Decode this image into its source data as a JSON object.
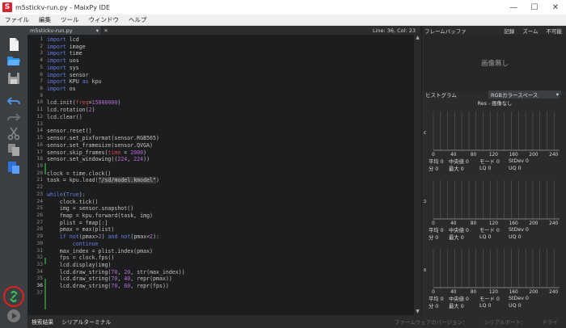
{
  "window": {
    "title": "m5stickv-run.py - MaixPy IDE",
    "logo_letter": "S",
    "minimize": "—",
    "maximize": "☐",
    "close": "✕"
  },
  "menu": [
    "ファイル",
    "編集",
    "ツール",
    "ウィンドウ",
    "ヘルプ"
  ],
  "toolbar": {
    "icons": [
      "new-file-icon",
      "open-folder-icon",
      "save-icon",
      "undo-icon",
      "redo-icon",
      "cut-icon",
      "copy-icon",
      "paste-icon",
      "connect-link-icon",
      "run-icon"
    ],
    "connect_highlight_color": "#e02020"
  },
  "editor": {
    "file_name": "m5stickv-run.py",
    "dropdown_arrow": "▾",
    "close_tab": "✕",
    "cursor_position": "Line: 36, Col: 23",
    "line_numbers": [
      "1",
      "2",
      "3",
      "4",
      "5",
      "6",
      "7",
      "8",
      "9",
      "10",
      "11",
      "12",
      "13",
      "14",
      "15",
      "16",
      "17",
      "18",
      "19",
      "20",
      "21",
      "22",
      "23",
      "24",
      "25",
      "26",
      "27",
      "28",
      "29",
      "30",
      "31",
      "32",
      "33",
      "34",
      "35",
      "36",
      "37"
    ]
  },
  "bottom": {
    "tabs": [
      "検索結果",
      "シリアルターミナル"
    ],
    "status_right": [
      "ファームウェアのバージョン：",
      "シリアルポート：",
      "ドライ"
    ]
  },
  "frame_buffer": {
    "title": "フレームバッファ",
    "controls": [
      "記録",
      "ズーム",
      "不可能"
    ],
    "no_image": "画像無し"
  },
  "histogram": {
    "title": "ヒストグラム",
    "color_space": "RGBカラースペース",
    "dropdown_arrow": "▾",
    "res_label": "Res - 画像なし",
    "x_ticks": [
      "0",
      "40",
      "80",
      "120",
      "160",
      "200",
      "240"
    ],
    "channels": [
      {
        "label": "R",
        "color": "#cccccc"
      },
      {
        "label": "G",
        "color": "#cccccc"
      },
      {
        "label": "B",
        "color": "#cccccc"
      }
    ],
    "stats_rows": [
      [
        "平均",
        "0",
        "中央値",
        "0",
        "モード",
        "0",
        "StDev",
        "0"
      ],
      [
        "分",
        "0",
        "最大",
        "0",
        "LQ",
        "0",
        "UQ",
        "0"
      ]
    ]
  }
}
